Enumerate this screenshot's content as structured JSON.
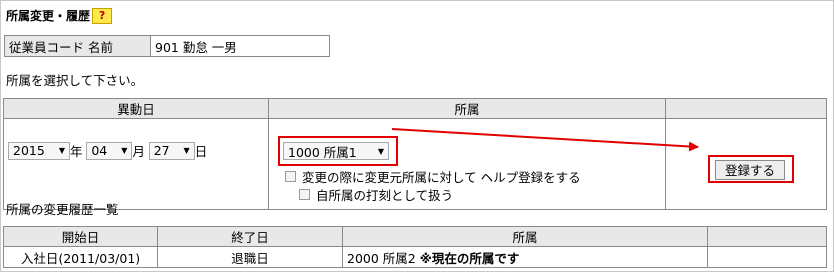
{
  "page": {
    "title": "所属変更・履歴",
    "help_label": "?"
  },
  "employee": {
    "label": "従業員コード 名前",
    "value": "901 勤怠 一男"
  },
  "instruction": "所属を選択して下さい。",
  "form": {
    "headers": [
      "異動日",
      "所属",
      ""
    ],
    "year": "2015",
    "year_unit": "年",
    "month": "04",
    "month_unit": "月",
    "day": "27",
    "day_unit": "日",
    "department": "1000 所属1",
    "help_register_label": "変更の際に変更元所属に対して ヘルプ登録をする",
    "own_dept_label": "自所属の打刻として扱う",
    "register_button": "登録する"
  },
  "history": {
    "title": "所属の変更履歴一覧",
    "headers": [
      "開始日",
      "終了日",
      "所属",
      ""
    ],
    "rows": [
      {
        "start": "入社日(2011/03/01)",
        "end": "退職日",
        "dept": "2000 所属2",
        "note": "※現在の所属です"
      }
    ]
  },
  "colors": {
    "highlight": "#e00000",
    "header_bg": "#e8e8e8",
    "help_bg": "#ffe94a"
  }
}
